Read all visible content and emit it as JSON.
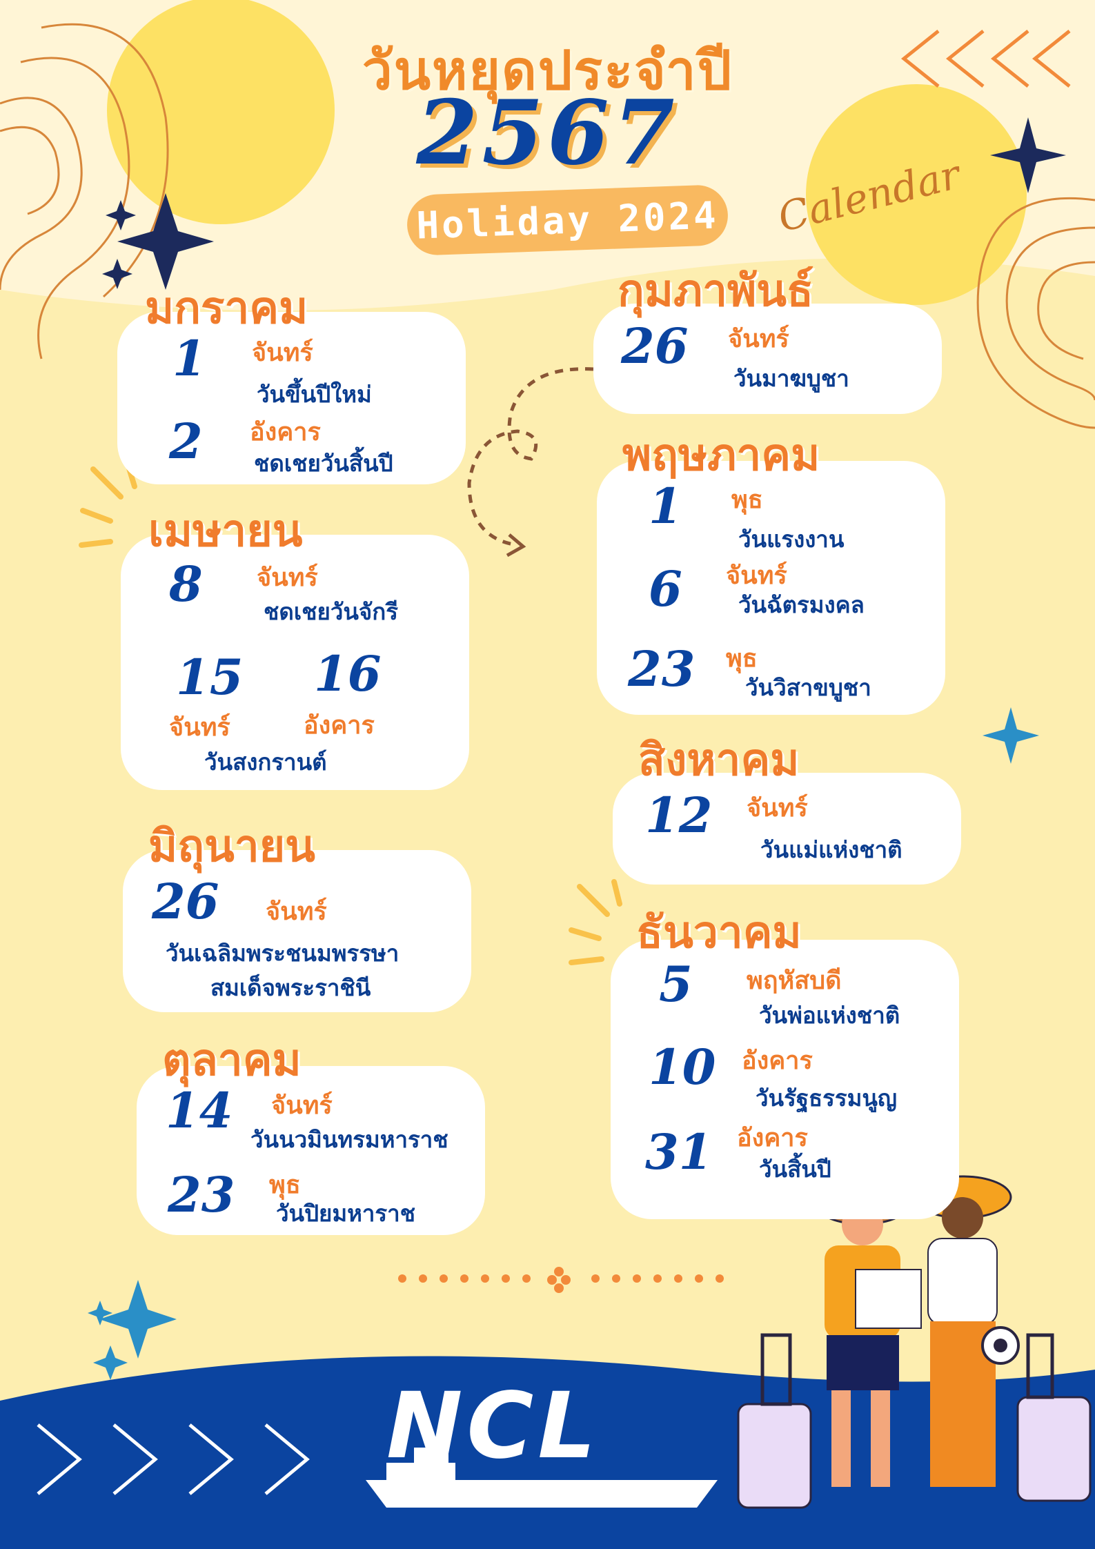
{
  "header": {
    "title_th": "วันหยุดประจำปี",
    "year": "2567",
    "holiday_label": "Holiday 2024",
    "calendar_word": "Calendar"
  },
  "months": {
    "jan": {
      "name": "มกราคม",
      "h1": {
        "day": "1",
        "weekday": "จันทร์",
        "name": "วันขึ้นปีใหม่"
      },
      "h2": {
        "day": "2",
        "weekday": "อังคาร",
        "name": "ชดเชยวันสิ้นปี"
      }
    },
    "apr": {
      "name": "เมษายน",
      "h1": {
        "day": "8",
        "weekday": "จันทร์",
        "name": "ชดเชยวันจักรี"
      },
      "h2": {
        "day": "15",
        "weekday": "จันทร์"
      },
      "h3": {
        "day": "16",
        "weekday": "อังคาร"
      },
      "songkran": "วันสงกรานต์"
    },
    "jun": {
      "name": "มิถุนายน",
      "h1": {
        "day": "26",
        "weekday": "จันทร์",
        "name_line1": "วันเฉลิมพระชนมพรรษา",
        "name_line2": "สมเด็จพระราชินี"
      }
    },
    "oct": {
      "name": "ตุลาคม",
      "h1": {
        "day": "14",
        "weekday": "จันทร์",
        "name": "วันนวมินทรมหาราช"
      },
      "h2": {
        "day": "23",
        "weekday": "พุธ",
        "name": "วันปิยมหาราช"
      }
    },
    "feb": {
      "name": "กุมภาพันธ์",
      "h1": {
        "day": "26",
        "weekday": "จันทร์",
        "name": "วันมาฆบูชา"
      }
    },
    "may": {
      "name": "พฤษภาคม",
      "h1": {
        "day": "1",
        "weekday": "พุธ",
        "name": "วันแรงงาน"
      },
      "h2": {
        "day": "6",
        "weekday": "จันทร์",
        "name": "วันฉัตรมงคล"
      },
      "h3": {
        "day": "23",
        "weekday": "พุธ",
        "name": "วันวิสาขบูชา"
      }
    },
    "aug": {
      "name": "สิงหาคม",
      "h1": {
        "day": "12",
        "weekday": "จันทร์",
        "name": "วันแม่แห่งชาติ"
      }
    },
    "dec": {
      "name": "ธันวาคม",
      "h1": {
        "day": "5",
        "weekday": "พฤหัสบดี",
        "name": "วันพ่อแห่งชาติ"
      },
      "h2": {
        "day": "10",
        "weekday": "อังคาร",
        "name": "วันรัฐธรรมนูญ"
      },
      "h3": {
        "day": "31",
        "weekday": "อังคาร",
        "name": "วันสิ้นปี"
      }
    }
  },
  "footer": {
    "logo_text": "NCL"
  },
  "colors": {
    "orange": "#f07c2c",
    "navy": "#0b44a0",
    "cream": "#fdeeb0",
    "sun": "#fde06a"
  },
  "icons": [
    "sparkle-icon",
    "chevrons-icon",
    "dashed-arrow-icon",
    "travelers-illustration",
    "ship-logo-icon"
  ]
}
